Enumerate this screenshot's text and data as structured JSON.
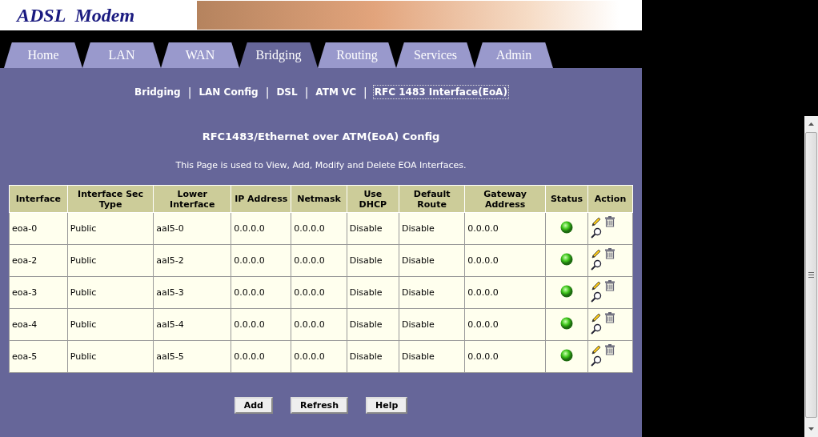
{
  "logo": "ADSL  Modem",
  "tabs": [
    {
      "label": "Home",
      "selected": false
    },
    {
      "label": "LAN",
      "selected": false
    },
    {
      "label": "WAN",
      "selected": false
    },
    {
      "label": "Bridging",
      "selected": true
    },
    {
      "label": "Routing",
      "selected": false
    },
    {
      "label": "Services",
      "selected": false
    },
    {
      "label": "Admin",
      "selected": false
    }
  ],
  "subnav": [
    {
      "label": "Bridging",
      "selected": false
    },
    {
      "label": "LAN Config",
      "selected": false
    },
    {
      "label": "DSL",
      "selected": false
    },
    {
      "label": "ATM VC",
      "selected": false
    },
    {
      "label": "RFC 1483 Interface(EoA)",
      "selected": true
    }
  ],
  "separator": "|",
  "title": "RFC1483/Ethernet over ATM(EoA) Config",
  "description": "This Page is used to View, Add, Modify and Delete EOA Interfaces.",
  "table": {
    "columns": [
      "Interface",
      "Interface Sec Type",
      "Lower Interface",
      "IP Address",
      "Netmask",
      "Use DHCP",
      "Default Route",
      "Gateway Address",
      "Status",
      "Action"
    ],
    "rows": [
      {
        "cells": [
          "eoa-0",
          "Public",
          "aal5-0",
          "0.0.0.0",
          "0.0.0.0",
          "Disable",
          "Disable",
          "0.0.0.0"
        ]
      },
      {
        "cells": [
          "eoa-2",
          "Public",
          "aal5-2",
          "0.0.0.0",
          "0.0.0.0",
          "Disable",
          "Disable",
          "0.0.0.0"
        ]
      },
      {
        "cells": [
          "eoa-3",
          "Public",
          "aal5-3",
          "0.0.0.0",
          "0.0.0.0",
          "Disable",
          "Disable",
          "0.0.0.0"
        ]
      },
      {
        "cells": [
          "eoa-4",
          "Public",
          "aal5-4",
          "0.0.0.0",
          "0.0.0.0",
          "Disable",
          "Disable",
          "0.0.0.0"
        ]
      },
      {
        "cells": [
          "eoa-5",
          "Public",
          "aal5-5",
          "0.0.0.0",
          "0.0.0.0",
          "Disable",
          "Disable",
          "0.0.0.0"
        ]
      }
    ]
  },
  "buttons": [
    "Add",
    "Refresh",
    "Help"
  ]
}
